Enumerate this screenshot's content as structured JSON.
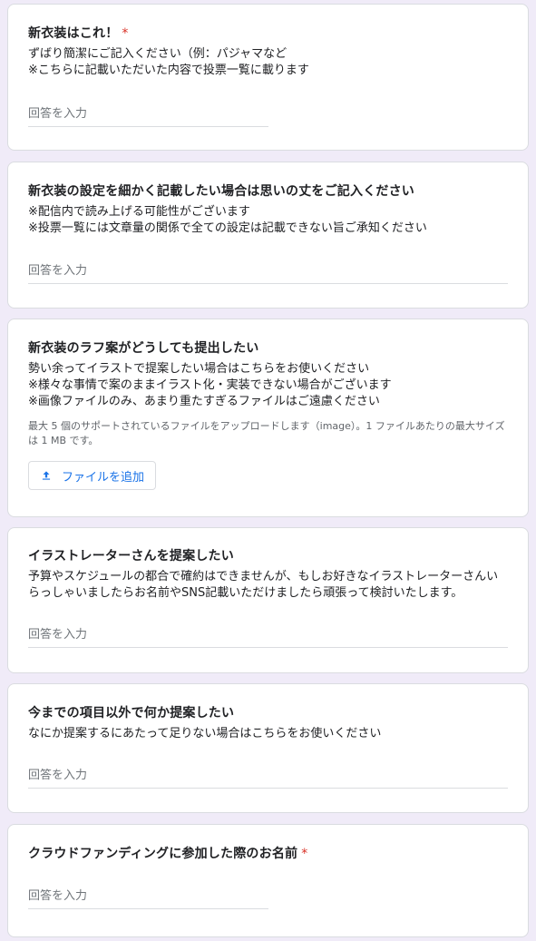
{
  "questions": [
    {
      "title": "新衣装はこれ！",
      "required_mark": "*",
      "desc": [
        "ずばり簡潔にご記入ください（例：パジャマなど",
        "※こちらに記載いただいた内容で投票一覧に載ります"
      ],
      "placeholder": "回答を入力"
    },
    {
      "title": "新衣装の設定を細かく記載したい場合は思いの丈をご記入ください",
      "desc": [
        "※配信内で読み上げる可能性がございます",
        "※投票一覧には文章量の関係で全ての設定は記載できない旨ご承知ください"
      ],
      "placeholder": "回答を入力"
    },
    {
      "title": "新衣装のラフ案がどうしても提出したい",
      "desc": [
        "勢い余ってイラストで提案したい場合はこちらをお使いください",
        "※様々な事情で案のままイラスト化・実装できない場合がございます",
        "※画像ファイルのみ、あまり重たすぎるファイルはご遠慮ください"
      ],
      "upload_note": [
        "最大 5 個のサポートされているファイルをアップロードします（image）。1 ファイルあたりの最大サイズ",
        "は 1 MB です。"
      ],
      "upload_button": "ファイルを追加"
    },
    {
      "title": "イラストレーターさんを提案したい",
      "desc": [
        "予算やスケジュールの都合で確約はできませんが、もしお好きなイラストレーターさんい",
        "らっしゃいましたらお名前やSNS記載いただけましたら頑張って検討いたします。"
      ],
      "placeholder": "回答を入力"
    },
    {
      "title": "今までの項目以外で何か提案したい",
      "desc": [
        "なにか提案するにあたって足りない場合はこちらをお使いください"
      ],
      "placeholder": "回答を入力"
    },
    {
      "title": "クラウドファンディングに参加した際のお名前",
      "required_mark": "*",
      "placeholder": "回答を入力"
    }
  ],
  "icons": {
    "upload": "upload-icon"
  },
  "colors": {
    "background": "#f0ebf8",
    "accent": "#1a73e8",
    "required": "#d93025"
  }
}
